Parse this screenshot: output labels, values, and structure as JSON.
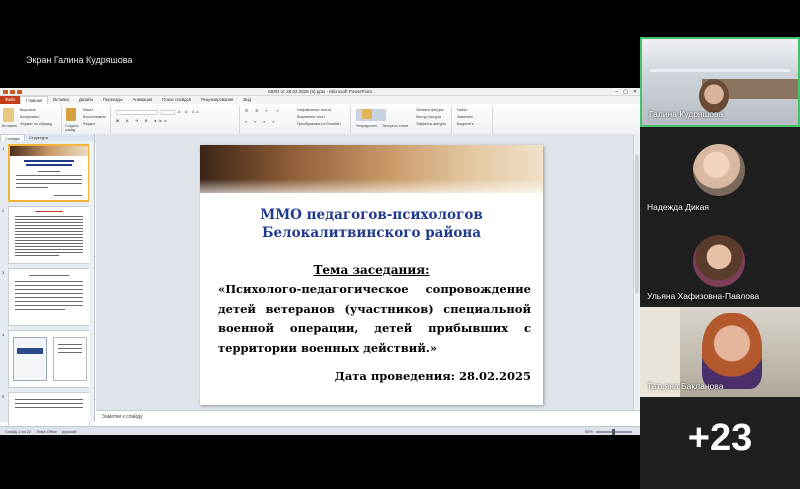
{
  "screen_share": {
    "label": "Экран Галина Кудряшова"
  },
  "powerpoint": {
    "window_title": "ММО от 28.02.2025 (6).pptx - Microsoft PowerPoint",
    "tabs": [
      "Файл",
      "Главная",
      "Вставка",
      "Дизайн",
      "Переходы",
      "Анимация",
      "Показ слайдов",
      "Рецензирование",
      "Вид"
    ],
    "active_tab": "Главная",
    "ribbon_groups": [
      "Буфер обмена",
      "Слайды",
      "Шрифт",
      "Абзац",
      "Рисование",
      "Редактирование"
    ],
    "ribbon_items": {
      "paste": "Вставить",
      "cut": "Вырезать",
      "copy": "Копировать",
      "format_painter": "Формат по образцу",
      "new_slide": "Создать слайд",
      "layout": "Макет",
      "reset": "Восстановить",
      "section": "Раздел",
      "text_direction": "Направление текста",
      "align_text": "Выровнять текст",
      "smartart": "Преобразовать в SmartArt",
      "arrange": "Упорядочить",
      "quick_styles": "Экспресс-стили",
      "shape_fill": "Заливка фигуры",
      "shape_outline": "Контур фигуры",
      "shape_effects": "Эффекты фигуры",
      "find": "Найти",
      "replace": "Заменить",
      "select": "Выделить"
    },
    "side_tabs": [
      "Слайды",
      "Структура"
    ],
    "slide_numbers": [
      "1",
      "2",
      "3",
      "4",
      "5"
    ],
    "slide": {
      "title_line1": "ММО педагогов-психологов",
      "title_line2": "Белокалитвинского района",
      "topic_heading": "Тема заседания:",
      "topic_body": "«Психолого-педагогическое сопровождение детей ветеранов (участников) специальной военной операции, детей прибывших с территории военных действий.»",
      "date": "Дата проведения: 28.02.2025"
    },
    "notes_placeholder": "Заметки к слайду",
    "status": {
      "slide_counter": "Слайд 1 из 22",
      "theme": "Тема Office",
      "language": "русский",
      "zoom": "55%"
    }
  },
  "participants": [
    {
      "name": "Галина Кудряшова",
      "speaking": true
    },
    {
      "name": "Надежда Дикая",
      "speaking": false
    },
    {
      "name": "Ульяна Хафизовна-Павлова",
      "speaking": false
    },
    {
      "name": "Татьяна Бакланова",
      "speaking": false
    }
  ],
  "more_participants": "+23",
  "colors": {
    "speaking_border": "#46c06a",
    "file_tab": "#c43e1c",
    "slide_title": "#1f3a8a"
  }
}
